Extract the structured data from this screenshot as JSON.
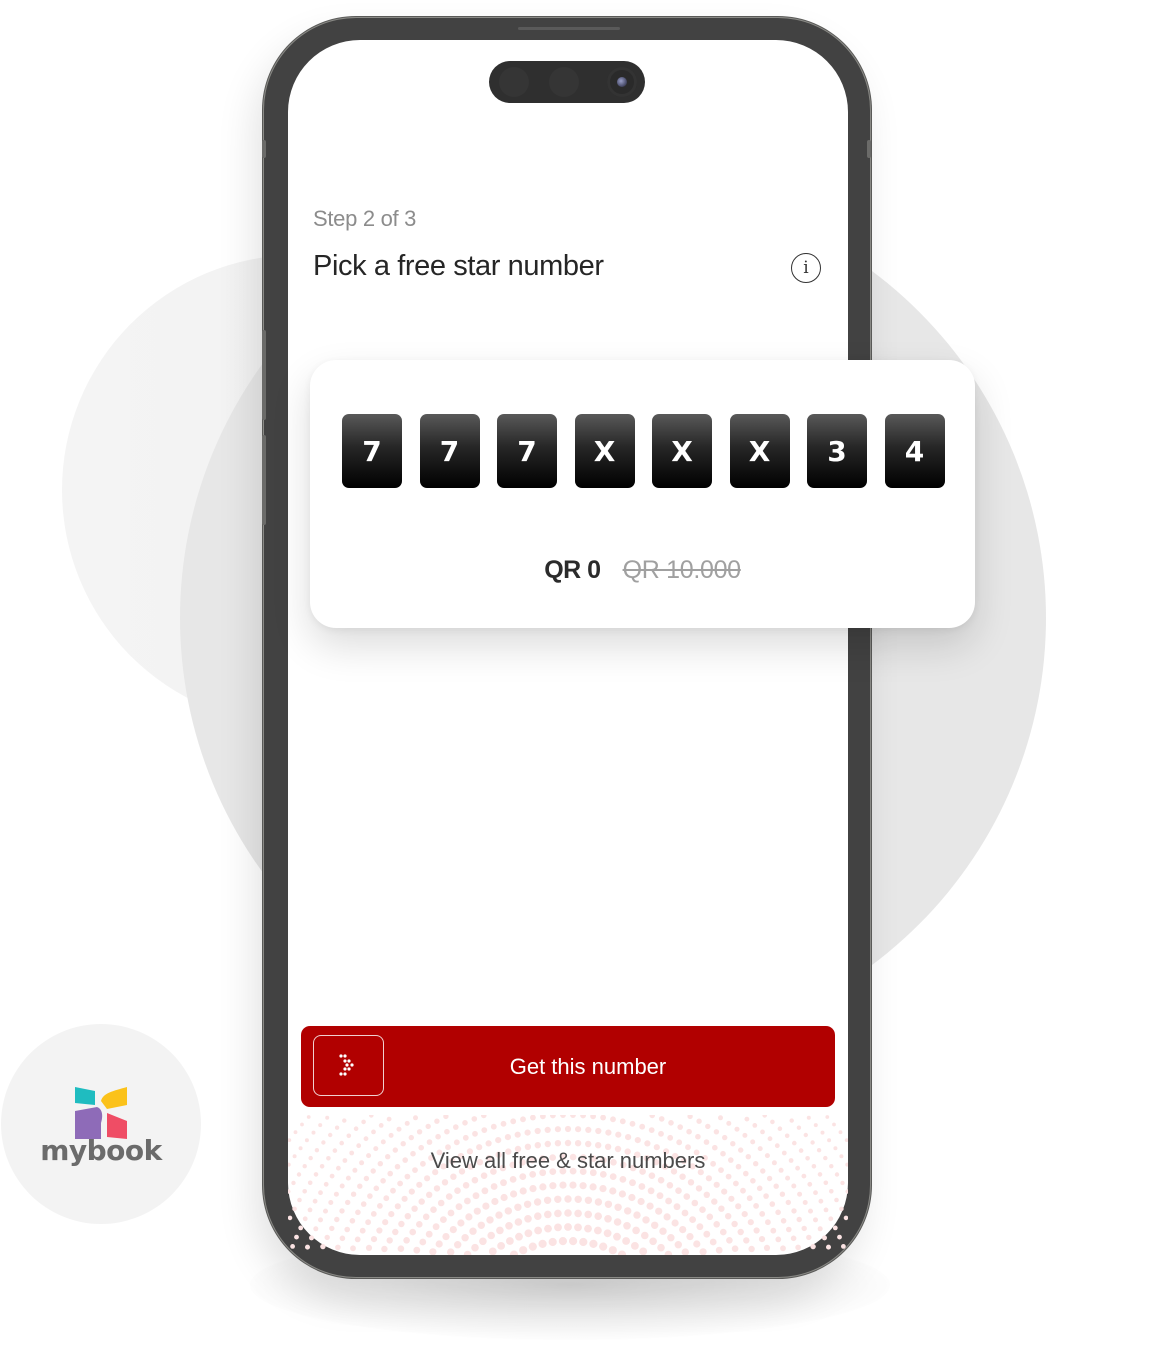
{
  "screen": {
    "step_label": "Step 2 of 3",
    "title": "Pick a free star number",
    "info_icon": "info-circle-icon"
  },
  "number_card": {
    "digits": [
      "7",
      "7",
      "7",
      "X",
      "X",
      "X",
      "3",
      "4"
    ],
    "price_current": "QR 0",
    "price_original": "QR 10.000"
  },
  "actions": {
    "primary_label": "Get this number",
    "primary_icon": "dotted-chevron-right-icon",
    "secondary_label": "View all free & star numbers"
  },
  "badge": {
    "brand": "mybook",
    "logo_colors": [
      "#1fbcc0",
      "#fbc21a",
      "#8e6bb8",
      "#ef4d65"
    ]
  },
  "colors": {
    "brand_red": "#b10000",
    "tile_dark": "#000000",
    "text_primary": "#262626",
    "text_muted": "#8c8c8c"
  }
}
